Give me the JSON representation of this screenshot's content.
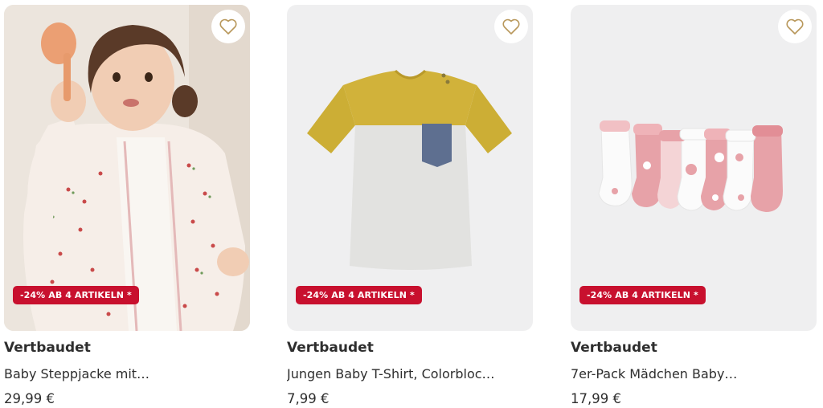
{
  "products": [
    {
      "brand": "Vertbaudet",
      "title": "Baby Steppjacke mit…",
      "price": "29,99 €",
      "badge": "-24% AB 4 ARTIKELN *",
      "image": "baby-quilted-jacket-photo",
      "favorite_icon": "heart-outline-icon"
    },
    {
      "brand": "Vertbaudet",
      "title": "Jungen Baby T-Shirt, Colorbloc…",
      "price": "7,99 €",
      "badge": "-24% AB 4 ARTIKELN *",
      "image": "colorblock-tshirt",
      "favorite_icon": "heart-outline-icon"
    },
    {
      "brand": "Vertbaudet",
      "title": "7er-Pack Mädchen Baby…",
      "price": "17,99 €",
      "badge": "-24% AB 4 ARTIKELN *",
      "image": "baby-socks-7-pack",
      "favorite_icon": "heart-outline-icon"
    }
  ],
  "colors": {
    "badge_bg": "#c8102e",
    "heart_stroke": "#b8975a",
    "tile_bg": "#efeff0",
    "text": "#2e2e2e"
  }
}
